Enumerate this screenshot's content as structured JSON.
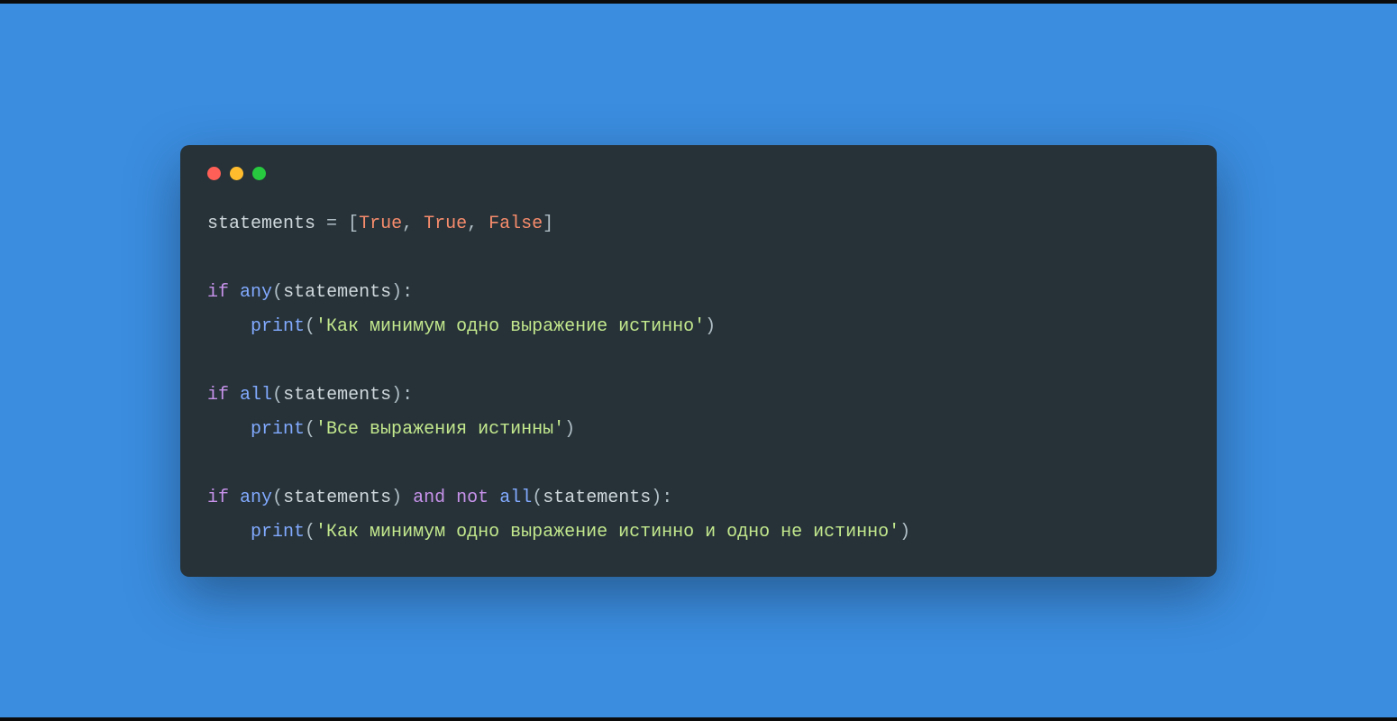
{
  "colors": {
    "background": "#3b8de0",
    "editor_bg": "#263238",
    "dot_red": "#ff5f56",
    "dot_yellow": "#ffbd2e",
    "dot_green": "#27c93f",
    "token_variable": "#cfd8dc",
    "token_operator": "#b0bec5",
    "token_boolean": "#f78c6c",
    "token_keyword": "#c792ea",
    "token_function": "#82aaff",
    "token_string": "#c3e88d"
  },
  "code": {
    "l1": {
      "var": "statements",
      "eq": " = ",
      "lb": "[",
      "b1": "True",
      "c1": ", ",
      "b2": "True",
      "c2": ", ",
      "b3": "False",
      "rb": "]"
    },
    "l3": {
      "kw": "if",
      "sp": " ",
      "fn": "any",
      "lp": "(",
      "arg": "statements",
      "rp": ")",
      "colon": ":"
    },
    "l4": {
      "indent": "    ",
      "fn": "print",
      "lp": "(",
      "str": "'Как минимум одно выражение истинно'",
      "rp": ")"
    },
    "l6": {
      "kw": "if",
      "sp": " ",
      "fn": "all",
      "lp": "(",
      "arg": "statements",
      "rp": ")",
      "colon": ":"
    },
    "l7": {
      "indent": "    ",
      "fn": "print",
      "lp": "(",
      "str": "'Все выражения истинны'",
      "rp": ")"
    },
    "l9": {
      "kw1": "if",
      "sp1": " ",
      "fn1": "any",
      "lp1": "(",
      "arg1": "statements",
      "rp1": ")",
      "sp2": " ",
      "kw2": "and",
      "sp3": " ",
      "kw3": "not",
      "sp4": " ",
      "fn2": "all",
      "lp2": "(",
      "arg2": "statements",
      "rp2": ")",
      "colon": ":"
    },
    "l10": {
      "indent": "    ",
      "fn": "print",
      "lp": "(",
      "str": "'Как минимум одно выражение истинно и одно не истинно'",
      "rp": ")"
    }
  }
}
